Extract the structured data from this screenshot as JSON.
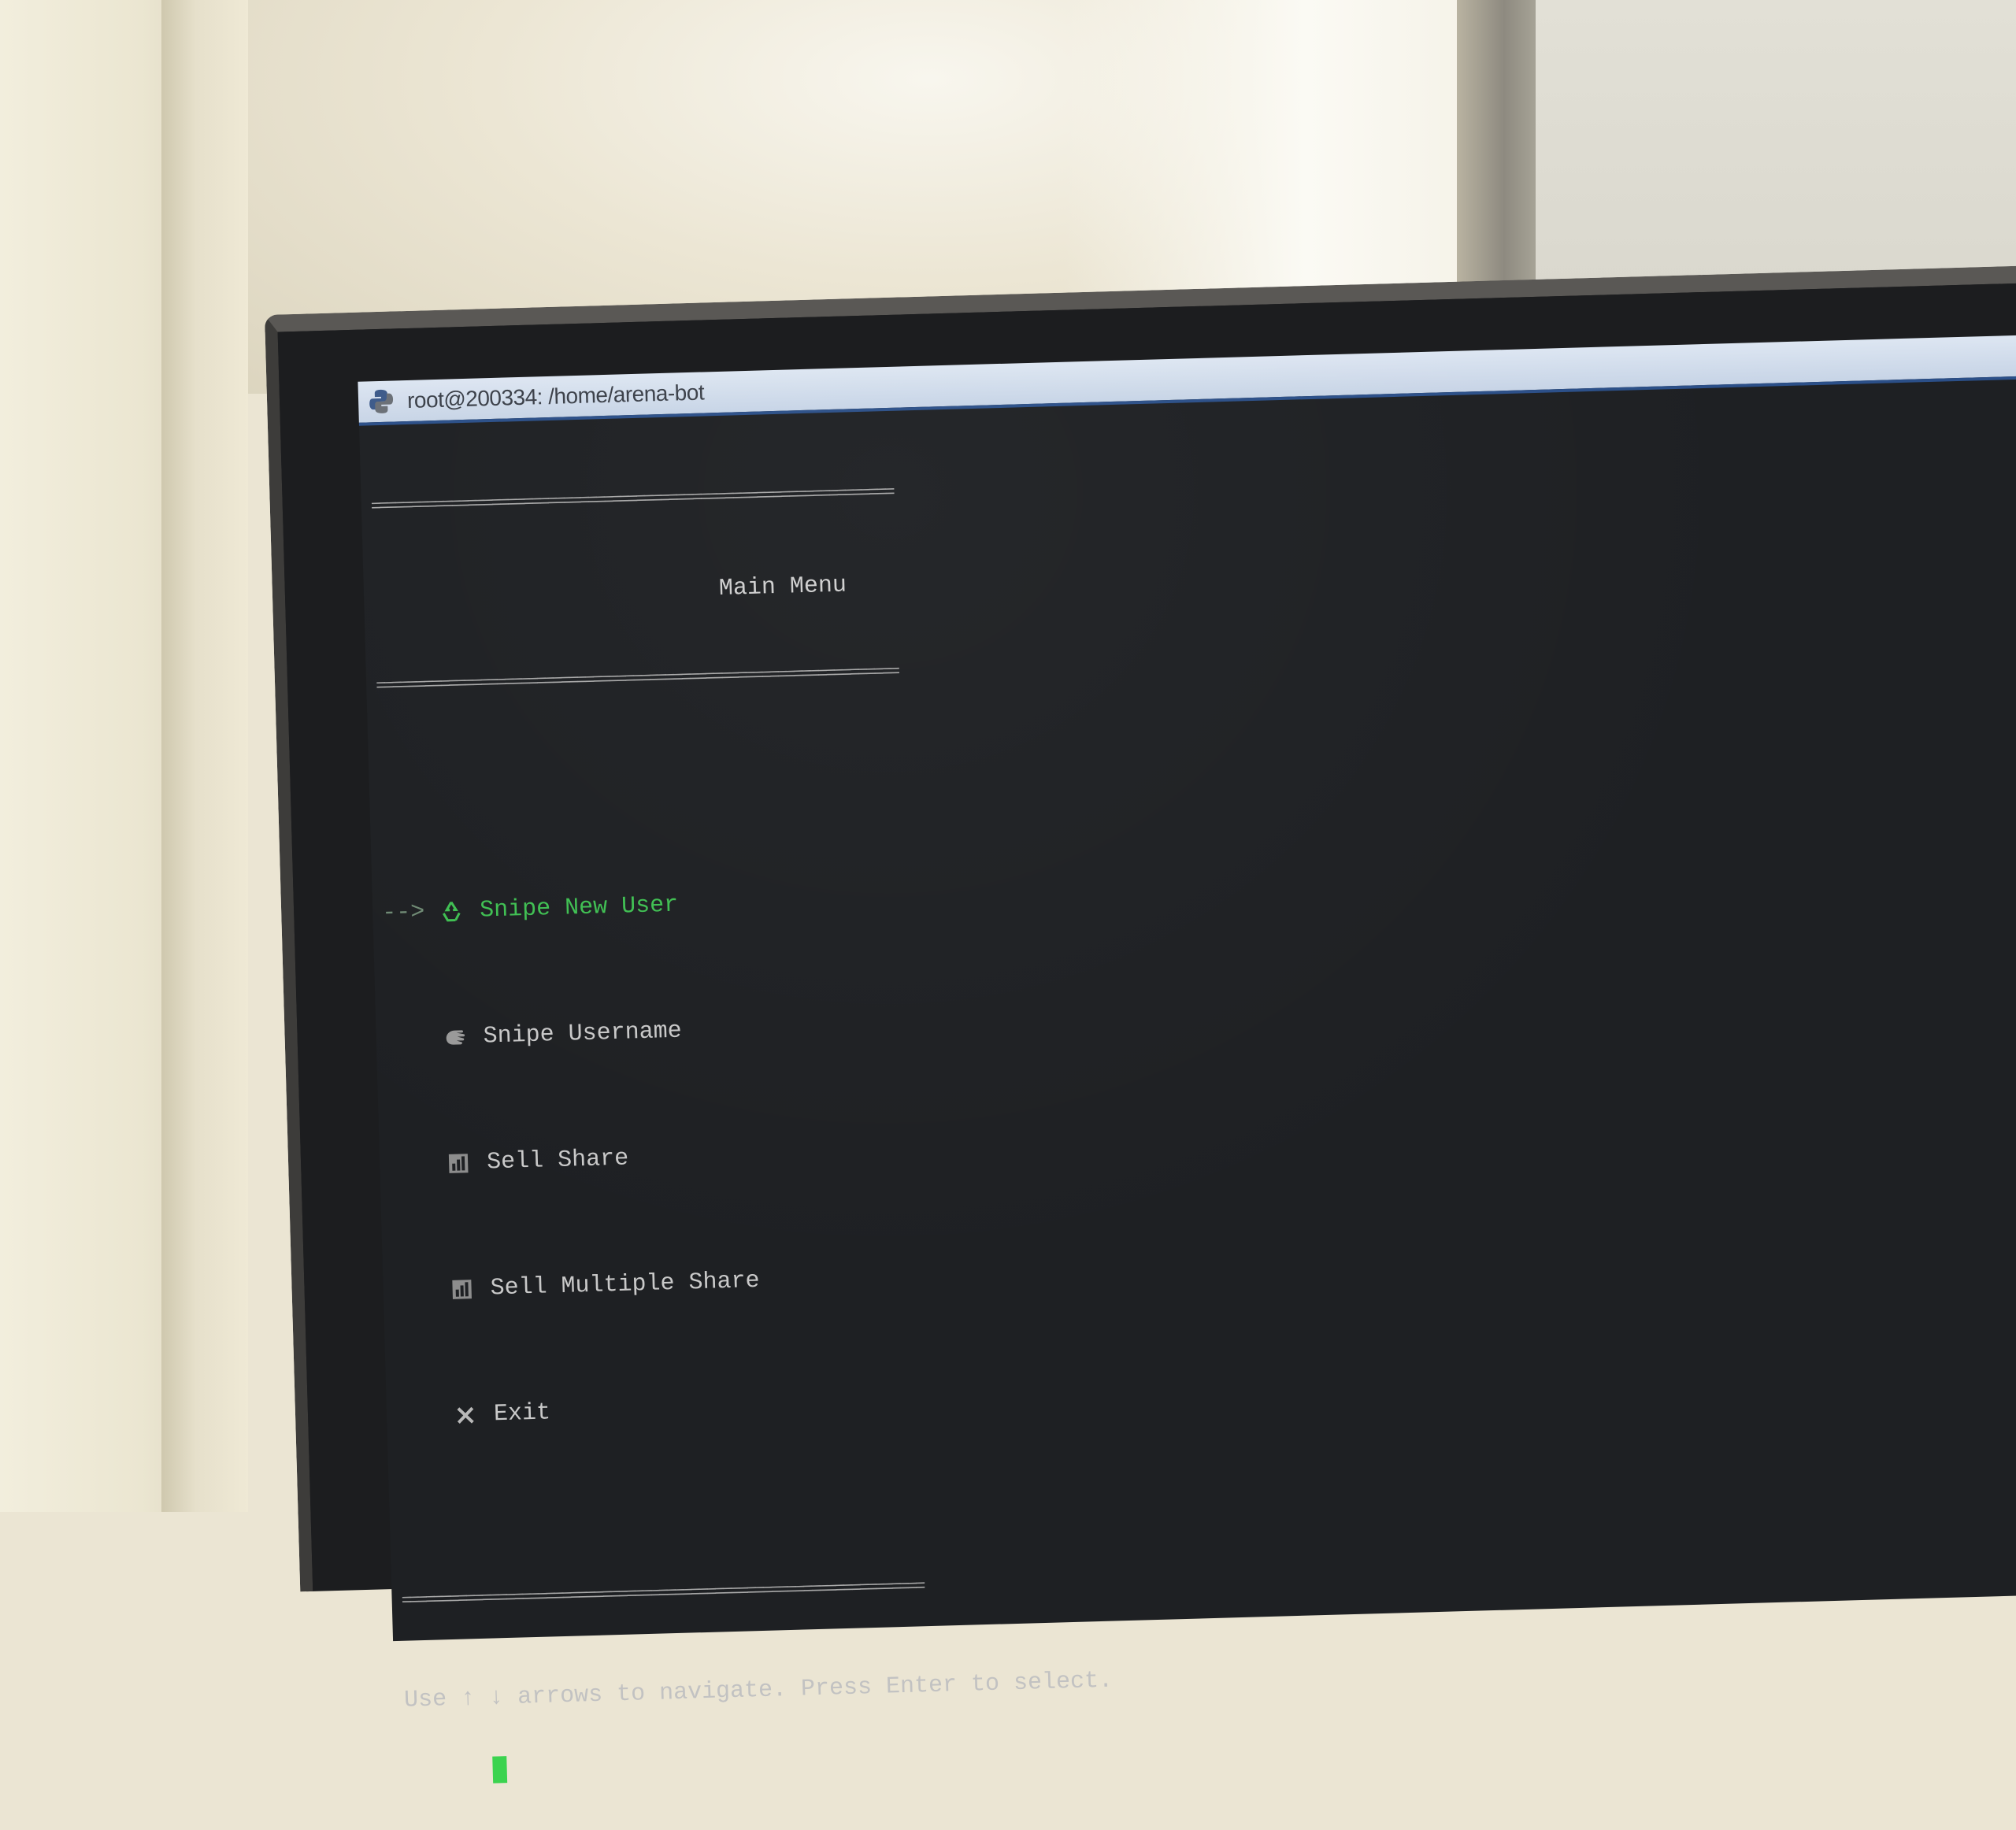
{
  "window": {
    "title": "root@200334: /home/arena-bot",
    "app_icon": "python-icon"
  },
  "menu": {
    "rule": "=================================================================",
    "title": "Main Menu",
    "selector": "-->",
    "items": [
      {
        "label": "Snipe New User",
        "icon": "recycle-icon",
        "selected": true
      },
      {
        "label": "Snipe Username",
        "icon": "hand-icon",
        "selected": false
      },
      {
        "label": "Sell Share",
        "icon": "chart-icon",
        "selected": false
      },
      {
        "label": "Sell Multiple Share",
        "icon": "chart-icon",
        "selected": false
      },
      {
        "label": "Exit",
        "icon": "close-icon",
        "selected": false
      }
    ],
    "help": "Use ↑ ↓ arrows to navigate. Press Enter to select."
  },
  "colors": {
    "selected_item": "#3fbf52",
    "terminal_text": "#c9c9c9",
    "terminal_bg": "#1e2023",
    "cursor": "#3bd34f"
  }
}
